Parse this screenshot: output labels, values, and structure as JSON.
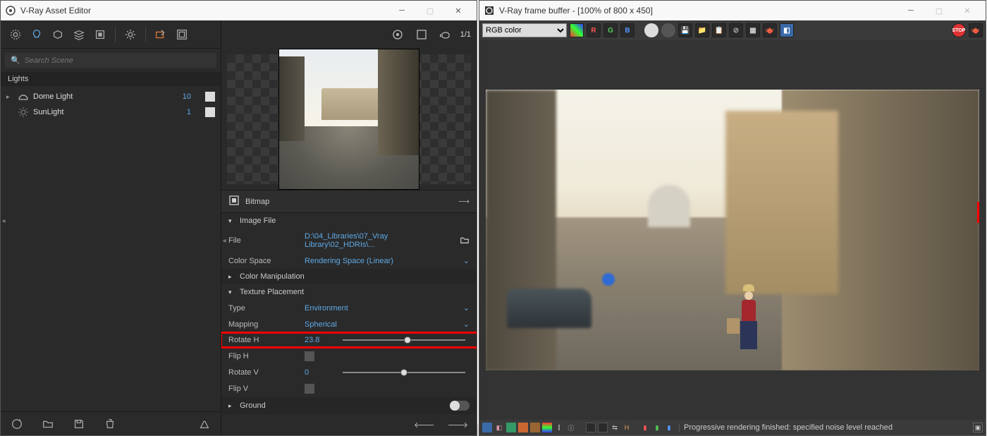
{
  "asset_editor": {
    "title": "V-Ray Asset Editor",
    "search_placeholder": "Search Scene",
    "page_indicator": "1/1",
    "section_lights": "Lights",
    "tree": [
      {
        "name": "Dome Light",
        "value": "10"
      },
      {
        "name": "SunLight",
        "value": "1"
      }
    ],
    "bitmap_header": "Bitmap",
    "groups": {
      "image_file": "Image File",
      "color_manipulation": "Color Manipulation",
      "texture_placement": "Texture Placement",
      "ground": "Ground"
    },
    "rows": {
      "file_label": "File",
      "file_value": "D:\\04_Libraries\\07_Vray Library\\02_HDRIs\\...",
      "colorspace_label": "Color Space",
      "colorspace_value": "Rendering Space (Linear)",
      "type_label": "Type",
      "type_value": "Environment",
      "mapping_label": "Mapping",
      "mapping_value": "Spherical",
      "rotateh_label": "Rotate H",
      "rotateh_value": "23.8",
      "fliph_label": "Flip H",
      "rotatev_label": "Rotate V",
      "rotatev_value": "0",
      "flipv_label": "Flip V"
    }
  },
  "vfb": {
    "title": "V-Ray frame buffer - [100% of 800 x 450]",
    "channel_select": "RGB color",
    "channels": {
      "r": "R",
      "g": "G",
      "b": "B"
    },
    "status": "Progressive rendering finished: specified noise level reached",
    "status_h": "H"
  },
  "colors": {
    "link": "#5fa9e6",
    "hl": "#f00"
  }
}
